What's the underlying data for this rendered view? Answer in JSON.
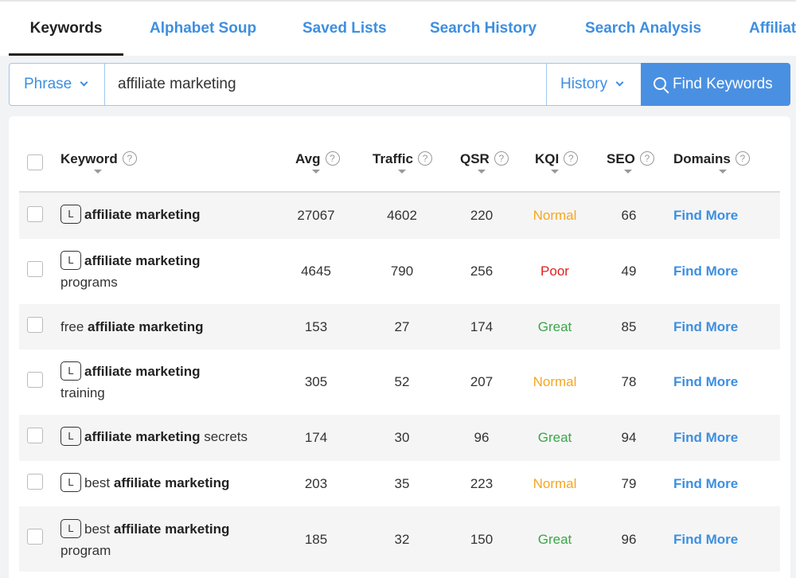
{
  "tabs": [
    {
      "label": "Keywords",
      "active": true
    },
    {
      "label": "Alphabet Soup",
      "active": false
    },
    {
      "label": "Saved Lists",
      "active": false
    },
    {
      "label": "Search History",
      "active": false
    },
    {
      "label": "Search Analysis",
      "active": false
    },
    {
      "label": "Affiliat",
      "active": false
    }
  ],
  "search": {
    "mode": "Phrase",
    "query": "affiliate marketing",
    "history_label": "History",
    "button_label": "Find Keywords"
  },
  "columns": {
    "keyword": "Keyword",
    "avg": "Avg",
    "traffic": "Traffic",
    "qsr": "QSR",
    "kqi": "KQI",
    "seo": "SEO",
    "domains": "Domains"
  },
  "help_glyph": "?",
  "badge_label": "L",
  "colors": {
    "accent": "#3d8fe0",
    "normal": "#f5a623",
    "poor": "#e02020",
    "great": "#3aa64a"
  },
  "rows": [
    {
      "badge": true,
      "pre": "",
      "bold": "affiliate marketing",
      "post": "",
      "avg": "27067",
      "traffic": "4602",
      "qsr": "220",
      "kqi": "Normal",
      "seo": "66",
      "domains": "Find More"
    },
    {
      "badge": true,
      "pre": "",
      "bold": "affiliate marketing",
      "post": "programs",
      "avg": "4645",
      "traffic": "790",
      "qsr": "256",
      "kqi": "Poor",
      "seo": "49",
      "domains": "Find More"
    },
    {
      "badge": false,
      "pre": "free ",
      "bold": "affiliate marketing",
      "post": "",
      "avg": "153",
      "traffic": "27",
      "qsr": "174",
      "kqi": "Great",
      "seo": "85",
      "domains": "Find More"
    },
    {
      "badge": true,
      "pre": "",
      "bold": "affiliate marketing",
      "post": "training",
      "avg": "305",
      "traffic": "52",
      "qsr": "207",
      "kqi": "Normal",
      "seo": "78",
      "domains": "Find More"
    },
    {
      "badge": true,
      "pre": "",
      "bold": "affiliate marketing",
      "post": " secrets",
      "avg": "174",
      "traffic": "30",
      "qsr": "96",
      "kqi": "Great",
      "seo": "94",
      "domains": "Find More"
    },
    {
      "badge": true,
      "pre": "best ",
      "bold": "affiliate marketing",
      "post": "",
      "avg": "203",
      "traffic": "35",
      "qsr": "223",
      "kqi": "Normal",
      "seo": "79",
      "domains": "Find More"
    },
    {
      "badge": true,
      "pre": "best ",
      "bold": "affiliate marketing",
      "post": "program",
      "avg": "185",
      "traffic": "32",
      "qsr": "150",
      "kqi": "Great",
      "seo": "96",
      "domains": "Find More"
    }
  ]
}
